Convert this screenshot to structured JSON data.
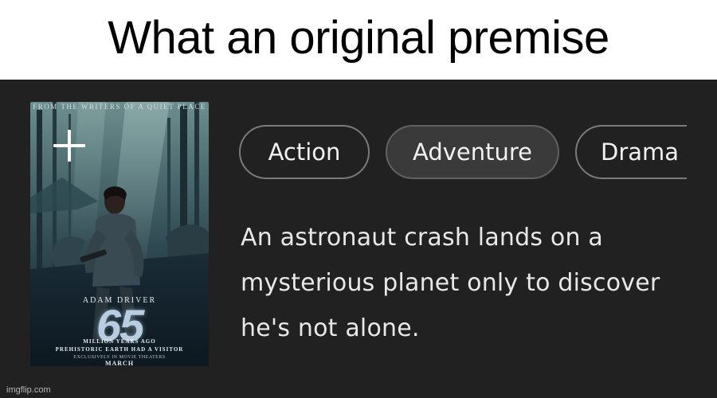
{
  "caption": "What an original premise",
  "poster": {
    "tagline": "FROM THE WRITERS OF A QUIET PLACE",
    "actor": "ADAM DRIVER",
    "title": "65",
    "line1": "MILLION YEARS AGO",
    "line2": "PREHISTORIC EARTH HAD A VISITOR",
    "release": "EXCLUSIVELY IN MOVIE THEATERS",
    "month": "MARCH",
    "add_icon": "plus-icon"
  },
  "genres": [
    "Action",
    "Adventure",
    "Drama"
  ],
  "description": "An astronaut crash lands on a mysterious planet only to discover he's not alone.",
  "watermark": "imgflip.com",
  "colors": {
    "background": "#212121",
    "chip_border": "#7b7b7b",
    "chip_selected_bg": "#3a3a3a",
    "text": "#e8e8e8"
  }
}
